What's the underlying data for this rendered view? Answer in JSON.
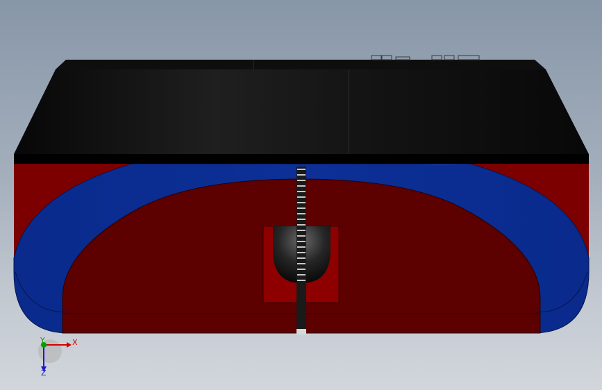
{
  "triad": {
    "x_label": "X",
    "y_label": "Y",
    "z_label": "Z"
  },
  "colors": {
    "background_top": "#8796a8",
    "background_bottom": "#d2d6dc",
    "lid": "#0b0b0b",
    "body_red": "#7d0000",
    "inner_red": "#5c0000",
    "blue_band": "#0a2a8c",
    "cutout_red": "#8e0000",
    "axis_x": "#d40000",
    "axis_y": "#00a000",
    "axis_z": "#1a1ad4"
  }
}
